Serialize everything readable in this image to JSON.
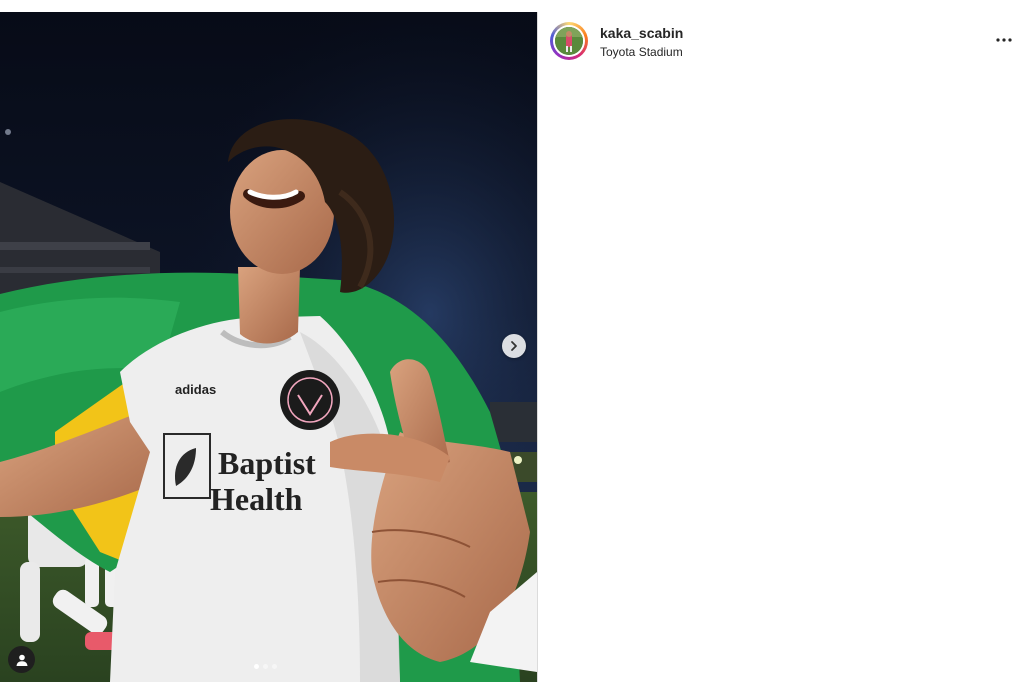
{
  "post": {
    "username": "kaka_scabin",
    "location": "Toyota Stadium"
  },
  "media": {
    "shirt_sponsor_line1": "Baptist",
    "shirt_sponsor_line2": "Health",
    "shirt_brand": "adidas",
    "carousel": {
      "total_slides": 3,
      "active_slide": 1
    }
  },
  "icons": {
    "next": "chevron-right-icon",
    "tagged_user": "user-icon",
    "more": "more-horizontal-icon"
  },
  "colors": {
    "text_primary": "#262626",
    "divider": "#dbdbdb",
    "flag_green": "#1f9a4a",
    "flag_yellow": "#f2c418"
  }
}
